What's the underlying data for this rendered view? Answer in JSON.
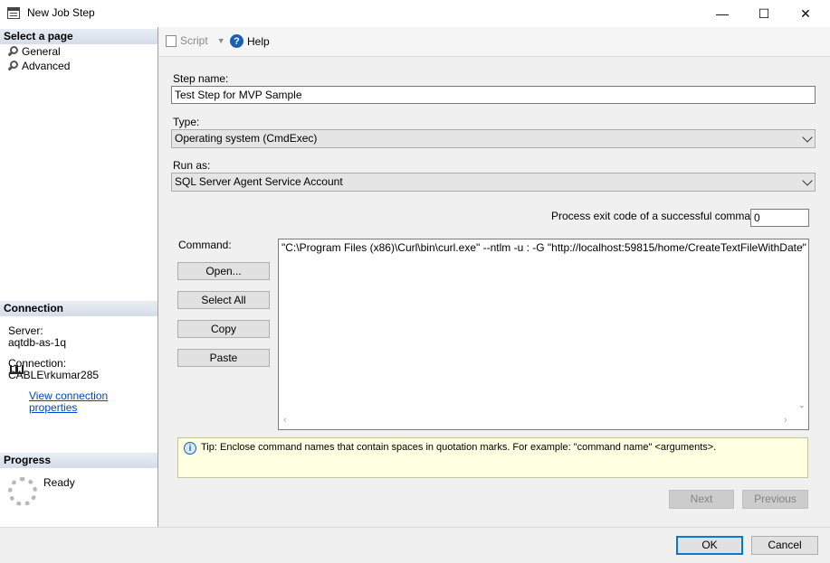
{
  "window": {
    "title": "New Job Step",
    "minimize": "—",
    "maximize": "☐",
    "close": "✕"
  },
  "left": {
    "select_page_title": "Select a page",
    "pages": [
      {
        "label": "General"
      },
      {
        "label": "Advanced"
      }
    ],
    "connection_title": "Connection",
    "server_label": "Server:",
    "server_value": "aqtdb-as-1q",
    "connection_label": "Connection:",
    "connection_value": "CABLE\\rkumar285",
    "view_props_link": "View connection properties",
    "progress_title": "Progress",
    "progress_status": "Ready"
  },
  "toolbar": {
    "script_label": "Script",
    "help_label": "Help"
  },
  "form": {
    "step_name_label": "Step name:",
    "step_name_value": "Test Step for MVP Sample",
    "type_label": "Type:",
    "type_value": "Operating system (CmdExec)",
    "run_as_label": "Run as:",
    "run_as_value": "SQL Server Agent Service Account",
    "exit_code_label": "Process exit code of a successful command:",
    "exit_code_value": "0",
    "command_label": "Command:",
    "command_value": "\"C:\\Program Files (x86)\\Curl\\bin\\curl.exe\" --ntlm -u : -G \"http://localhost:59815/home/CreateTextFileWithDate\"",
    "open_button": "Open...",
    "select_all_button": "Select All",
    "copy_button": "Copy",
    "paste_button": "Paste",
    "tip_text": "Tip: Enclose command names that contain spaces in quotation marks. For example: \"command name\" <arguments>.",
    "next_button": "Next",
    "previous_button": "Previous"
  },
  "footer": {
    "ok_button": "OK",
    "cancel_button": "Cancel"
  }
}
